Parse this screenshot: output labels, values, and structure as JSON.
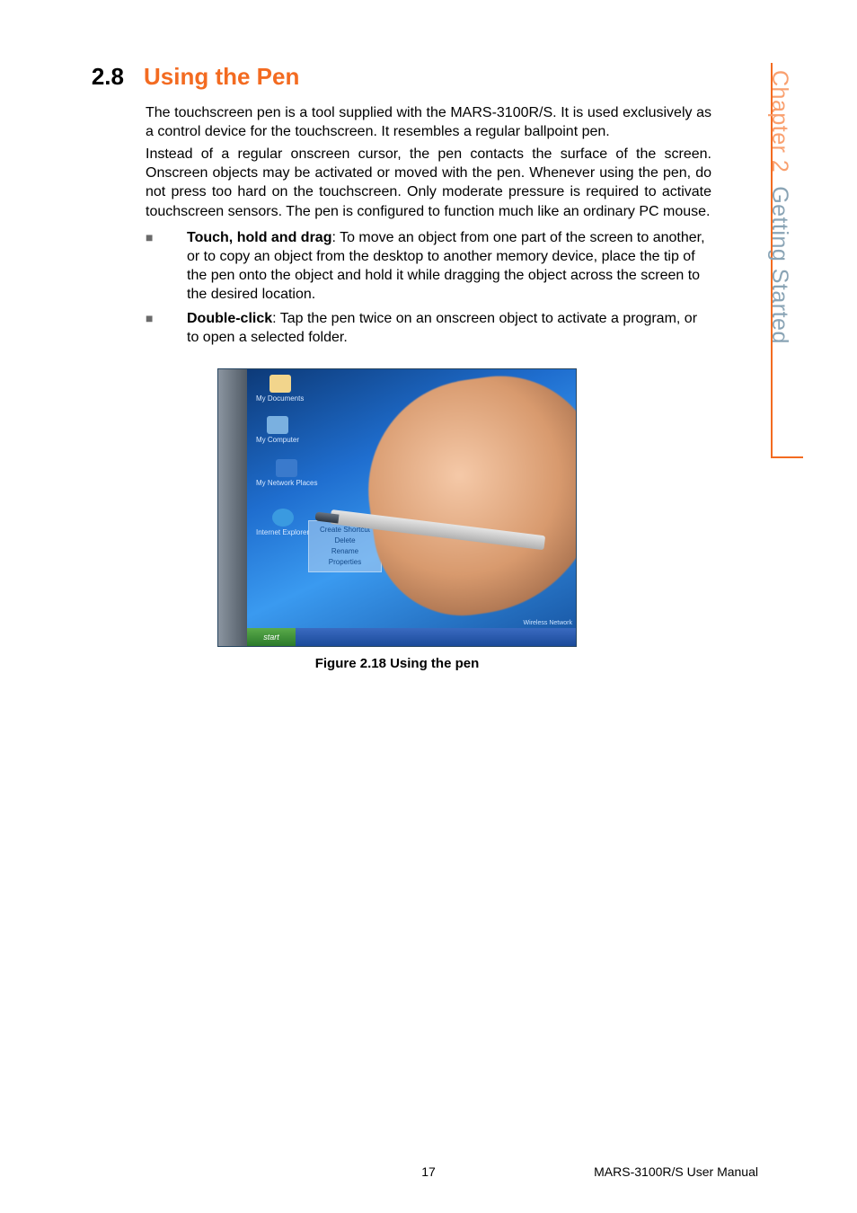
{
  "sidetab": {
    "chapter": "Chapter 2",
    "title": "Getting Started"
  },
  "section": {
    "number": "2.8",
    "title": "Using the Pen"
  },
  "paragraphs": {
    "p1": "The touchscreen pen is a tool supplied with the MARS-3100R/S. It is used exclusively as a control device for the touchscreen. It resembles a regular ballpoint pen.",
    "p2": "Instead of a regular onscreen cursor, the pen contacts the surface of the screen. Onscreen objects may be activated or moved with the pen. Whenever using the pen, do not press too hard on the touchscreen. Only moderate pressure is required to activate touchscreen sensors. The pen is configured to function much like an ordinary PC mouse."
  },
  "bullets": {
    "b1_bold": "Touch, hold and drag",
    "b1_rest": ": To move an object from one part of the screen to another, or to copy an object from the desktop to another memory device, place the tip of the pen onto the object and hold it while dragging the object across the screen to the desired location.",
    "b2_bold": "Double-click",
    "b2_rest": ": Tap the pen twice on an onscreen object to activate a program, or to open a selected folder."
  },
  "figure": {
    "icons": {
      "docs": "My Documents",
      "comp": "My Computer",
      "net": "My Network Places",
      "ie": "Internet Explorer"
    },
    "menu": {
      "m1": "Create Shortcut",
      "m2": "Delete",
      "m3": "Rename",
      "m4": "Properties"
    },
    "start": "start",
    "tray": "Wireless Network",
    "caption": "Figure 2.18 Using the pen"
  },
  "footer": {
    "page": "17",
    "manual": "MARS-3100R/S User Manual"
  }
}
